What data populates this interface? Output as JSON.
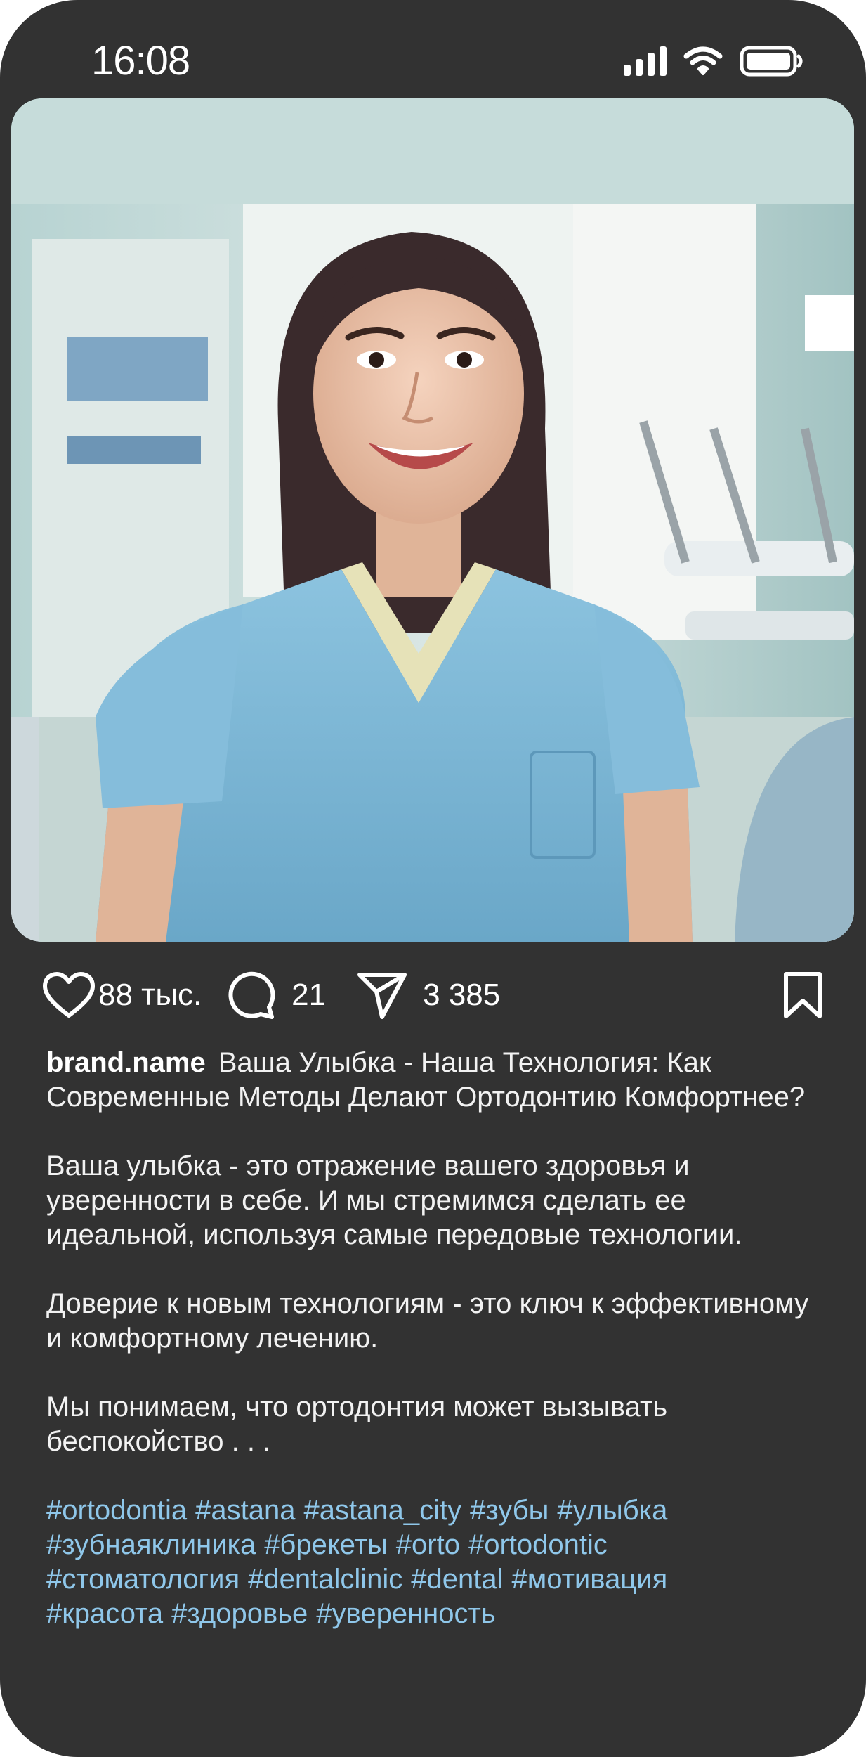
{
  "status_bar": {
    "time": "16:08"
  },
  "post": {
    "image_description_icon": "photo-dentist-smiling",
    "actions": {
      "likes": "88 тыс.",
      "comments": "21",
      "shares": "3 385"
    },
    "username": "brand.name",
    "caption": {
      "title": "Ваша Улыбка - Наша Технология: Как Современные Методы Делают Ортодонтию Комфортнее?",
      "paragraph_1": "Ваша улыбка - это отражение вашего здоровья и уверенности в себе. И мы стремимся сделать ее идеальной, используя самые передовые технологии.",
      "paragraph_2": "Доверие к новым технологиям - это ключ к эффективному и комфортному лечению.",
      "paragraph_3": "Мы понимаем, что ортодонтия может вызывать беспокойство . . ."
    },
    "hashtags": [
      "#ortodontia",
      "#astana",
      "#astana_city",
      "#зубы",
      "#улыбка",
      "#зубнаяклиника",
      "#брекеты",
      "#orto",
      "#ortodontic",
      "#стоматология",
      "#dentalclinic",
      "#dental",
      "#мотивация",
      "#красота",
      "#здоровье",
      "#уверенность"
    ]
  },
  "colors": {
    "background": "#323232",
    "text": "#ffffff",
    "hashtag": "#8fc7ea"
  }
}
